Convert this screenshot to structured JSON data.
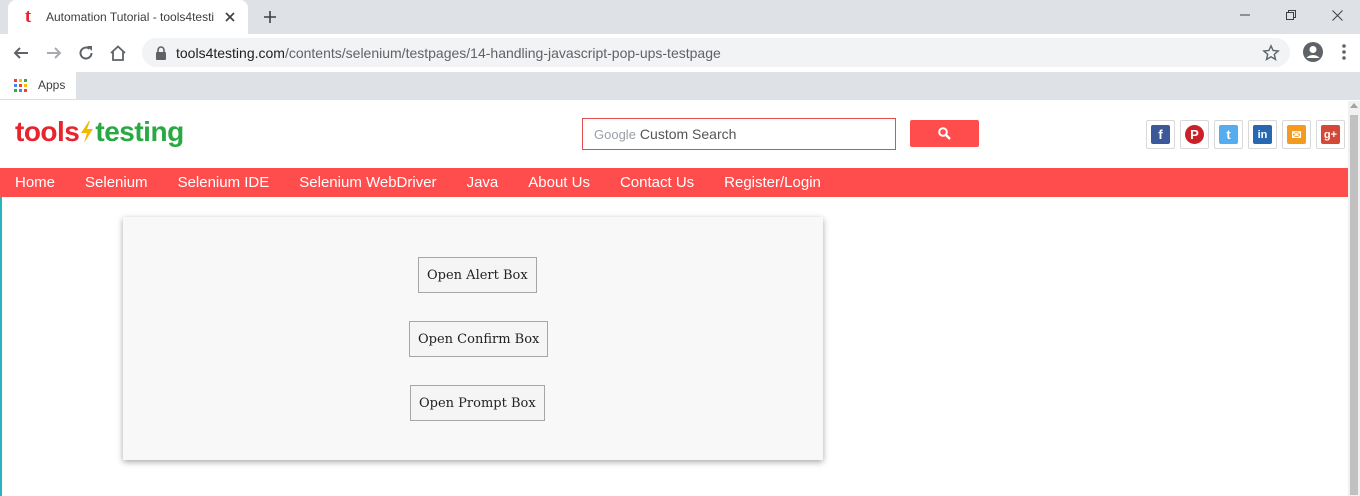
{
  "browser": {
    "tab": {
      "title": "Automation Tutorial - tools4testi",
      "favicon_letter": "t"
    },
    "address": {
      "host": "tools4testing.com",
      "path": "/contents/selenium/testpages/14-handling-javascript-pop-ups-testpage"
    },
    "bookmarks": {
      "apps_label": "Apps"
    }
  },
  "site": {
    "logo": {
      "part1": "tools",
      "bolt": "ϟ",
      "part2": "testing"
    },
    "search": {
      "brand": "Google",
      "placeholder": "Custom Search"
    },
    "social": [
      {
        "name": "facebook",
        "glyph": "f",
        "color": "#3b5998"
      },
      {
        "name": "pinterest",
        "glyph": "P",
        "color": "#cb2027"
      },
      {
        "name": "twitter",
        "glyph": "t",
        "color": "#55acee"
      },
      {
        "name": "linkedin",
        "glyph": "in",
        "color": "#2867b2"
      },
      {
        "name": "email",
        "glyph": "✉",
        "color": "#f49a1f"
      },
      {
        "name": "google-plus",
        "glyph": "g+",
        "color": "#d34836"
      }
    ],
    "nav": [
      "Home",
      "Selenium",
      "Selenium IDE",
      "Selenium WebDriver",
      "Java",
      "About Us",
      "Contact Us",
      "Register/Login"
    ],
    "accent_color": "#ff4d4d"
  },
  "panel": {
    "buttons": [
      {
        "label": "Open Alert Box"
      },
      {
        "label": "Open Confirm Box"
      },
      {
        "label": "Open Prompt Box"
      }
    ]
  }
}
